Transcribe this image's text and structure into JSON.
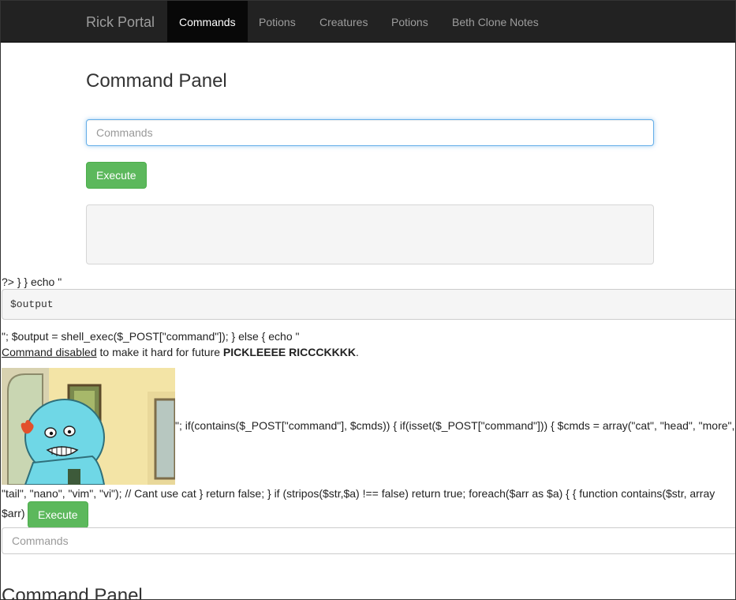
{
  "navbar": {
    "brand": "Rick Portal",
    "items": [
      {
        "label": "Commands",
        "active": true
      },
      {
        "label": "Potions",
        "active": false
      },
      {
        "label": "Creatures",
        "active": false
      },
      {
        "label": "Potions",
        "active": false
      },
      {
        "label": "Beth Clone Notes",
        "active": false
      }
    ]
  },
  "panel": {
    "title": "Command Panel",
    "input_placeholder": "Commands",
    "input_value": "",
    "execute_label": "Execute",
    "output_text": ""
  },
  "leaked": {
    "line1": "?> } } echo \"",
    "pre_text": "$output",
    "line2": "\"; $output = shell_exec($_POST[\"command\"]); } else { echo \"",
    "disabled_link": "Command disabled",
    "disabled_mid": " to make it hard for future ",
    "disabled_bold": "PICKLEEEE RICCCKKKK",
    "disabled_end": ".",
    "gif_caption": "\"; if(contains($_POST[\"command\"], $cmds)) { if(isset($_POST[\"command\"])) { $cmds = array(\"cat\", \"head\", \"more\",",
    "line3": "\"tail\", \"nano\", \"vim\", \"vi\"); // Cant use cat } return false; } if (stripos($str,$a) !== false) return true; foreach($arr as $a) { { function contains($str, array",
    "line4": "$arr)",
    "execute_label": "Execute",
    "input_placeholder": "Commands",
    "title": "Command Panel"
  },
  "image": {
    "icon": "mr-meeseeks-sad-image"
  },
  "colors": {
    "navbar": "#222222",
    "active_tab": "#080808",
    "success": "#5cb85c",
    "focus": "#66afe9"
  }
}
